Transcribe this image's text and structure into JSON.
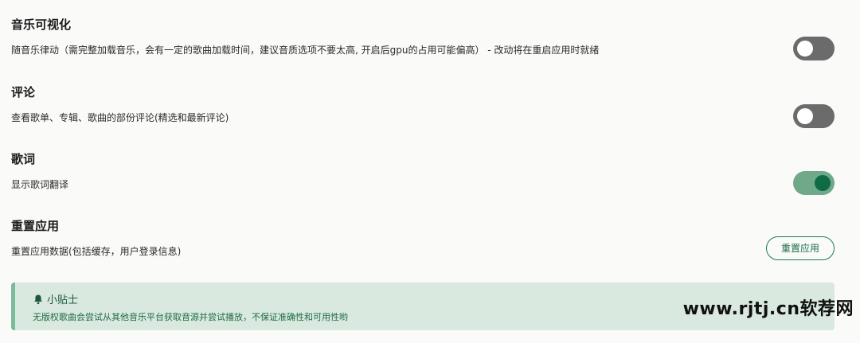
{
  "sections": [
    {
      "title": "音乐可视化",
      "description": "随音乐律动（需完整加载音乐，会有一定的歌曲加载时间，建议音质选项不要太高, 开启后gpu的占用可能偏高） - 改动将在重启应用时就绪",
      "toggle_state": "off"
    },
    {
      "title": "评论",
      "description": "查看歌单、专辑、歌曲的部份评论(精选和最新评论)",
      "toggle_state": "off"
    },
    {
      "title": "歌词",
      "description": "显示歌词翻译",
      "toggle_state": "on"
    },
    {
      "title": "重置应用",
      "description": "重置应用数据(包括缓存，用户登录信息)",
      "button_label": "重置应用"
    }
  ],
  "tip": {
    "title": "小贴士",
    "text": "无版权歌曲会尝试从其他音乐平台获取音源并尝试播放，不保证准确性和可用性哟",
    "icon": "bell-icon"
  },
  "watermark": "www.rjtj.cn软荐网",
  "colors": {
    "toggle_off": "#6b6b6b",
    "toggle_on_track": "#6fa98a",
    "toggle_on_knob": "#0e6b43",
    "tip_background": "#d9e9df",
    "tip_border": "#7cbb98",
    "accent": "#1f7a52"
  }
}
